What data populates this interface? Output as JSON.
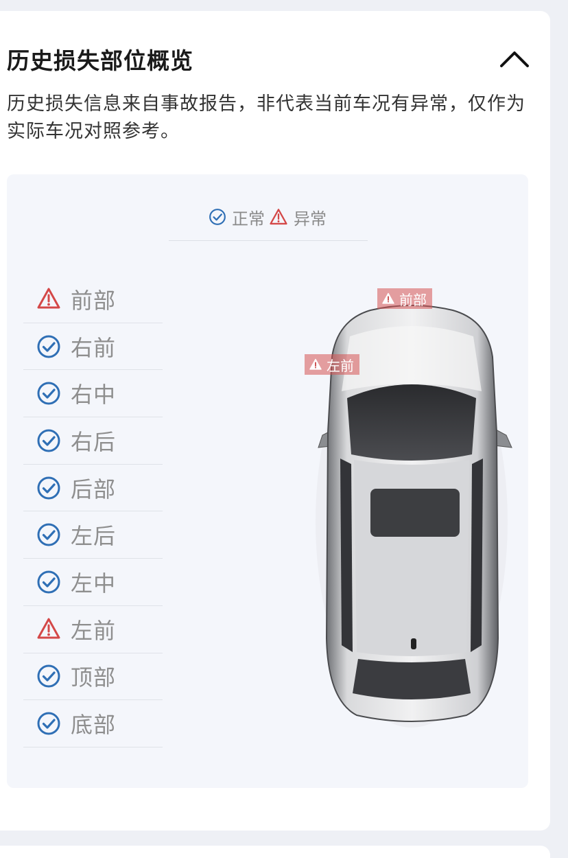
{
  "section": {
    "title": "历史损失部位概览",
    "description": "历史损失信息来自事故报告，非代表当前车况有异常，仅作为实际车况对照参考。"
  },
  "legend": {
    "normal_label": "正常",
    "abnormal_label": "异常"
  },
  "colors": {
    "normal": "#2f6fb5",
    "abnormal": "#d44848"
  },
  "parts": [
    {
      "label": "前部",
      "status": "abnormal",
      "icon": "warning-icon"
    },
    {
      "label": "右前",
      "status": "normal",
      "icon": "check-circle-icon"
    },
    {
      "label": "右中",
      "status": "normal",
      "icon": "check-circle-icon"
    },
    {
      "label": "右后",
      "status": "normal",
      "icon": "check-circle-icon"
    },
    {
      "label": "后部",
      "status": "normal",
      "icon": "check-circle-icon"
    },
    {
      "label": "左后",
      "status": "normal",
      "icon": "check-circle-icon"
    },
    {
      "label": "左中",
      "status": "normal",
      "icon": "check-circle-icon"
    },
    {
      "label": "左前",
      "status": "abnormal",
      "icon": "warning-icon"
    },
    {
      "label": "顶部",
      "status": "normal",
      "icon": "check-circle-icon"
    },
    {
      "label": "底部",
      "status": "normal",
      "icon": "check-circle-icon"
    }
  ],
  "car_tags": [
    {
      "label": "前部"
    },
    {
      "label": "左前"
    }
  ]
}
